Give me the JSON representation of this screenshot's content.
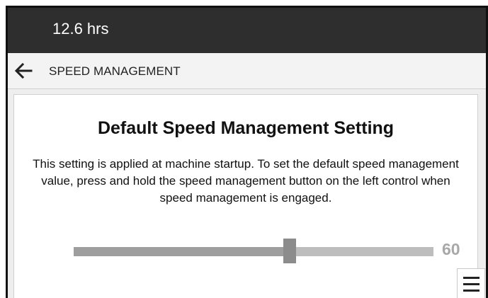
{
  "status": {
    "hours": "12.6 hrs"
  },
  "nav": {
    "back_icon": "arrow-left-icon",
    "title": "SPEED MANAGEMENT"
  },
  "setting": {
    "heading": "Default Speed Management Setting",
    "description": "This setting is applied at machine startup. To set the default speed management value, press and hold the speed management button on the left control when speed management is engaged.",
    "slider": {
      "fraction": 0.6,
      "value": "60"
    }
  },
  "menu": {
    "icon": "hamburger-menu-icon"
  },
  "colors": {
    "status_bar": "#2e2e2e",
    "track": "#bdbdbd",
    "fill": "#9e9e9e",
    "thumb": "#8c8c8c",
    "value_text": "#a8a8a8"
  }
}
